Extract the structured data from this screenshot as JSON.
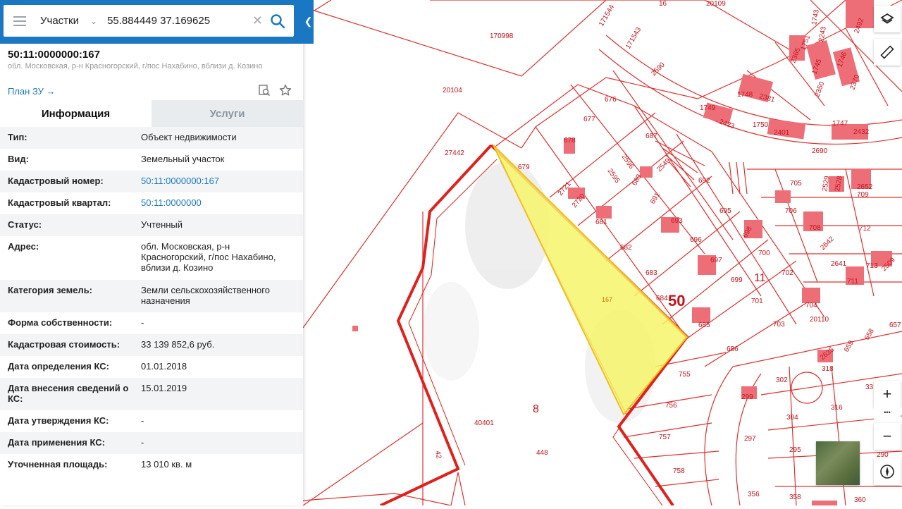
{
  "search": {
    "layer": "Участки",
    "query": "55.884449 37.169625"
  },
  "object": {
    "cadastral_number": "50:11:0000000:167",
    "address_short": "обл. Московская, р-н Красногорский, г/пос Нахабино, вблизи д. Козино",
    "plan_link": "План ЗУ"
  },
  "tabs": [
    {
      "label": "Информация",
      "active": true
    },
    {
      "label": "Услуги",
      "active": false
    }
  ],
  "info": [
    {
      "key": "Тип:",
      "value": "Объект недвижимости"
    },
    {
      "key": "Вид:",
      "value": "Земельный участок"
    },
    {
      "key": "Кадастровый номер:",
      "value": "50:11:0000000:167",
      "link": true
    },
    {
      "key": "Кадастровый квартал:",
      "value": "50:11:0000000",
      "link": true
    },
    {
      "key": "Статус:",
      "value": "Учтенный"
    },
    {
      "key": "Адрес:",
      "value": "обл. Московская, р-н Красногорский, г/пос Нахабино, вблизи д. Козино"
    },
    {
      "key": "Категория земель:",
      "value": "Земли сельскохозяйственного назначения"
    },
    {
      "key": "Форма собственности:",
      "value": "-"
    },
    {
      "key": "Кадастровая стоимость:",
      "value": "33 139 852,6 руб."
    },
    {
      "key": "Дата определения КС:",
      "value": "01.01.2018"
    },
    {
      "key": "Дата внесения сведений о КС:",
      "value": "15.01.2019"
    },
    {
      "key": "Дата утверждения КС:",
      "value": "-"
    },
    {
      "key": "Дата применения КС:",
      "value": "-"
    },
    {
      "key": "Уточненная площадь:",
      "value": "13 010 кв. м"
    }
  ],
  "map": {
    "highlight_color": "#f5f56a",
    "boundary_color": "#d0021b",
    "big_labels": [
      "8",
      "50",
      "11"
    ],
    "selected_label": "167",
    "labels": [
      "16",
      "20109",
      "170998",
      "171544",
      "171543",
      "2590",
      "20104",
      "27442",
      "676",
      "677",
      "678",
      "687",
      "679",
      "2596",
      "2595",
      "689",
      "2549",
      "692",
      "691",
      "2721",
      "2720",
      "681",
      "693",
      "695",
      "696",
      "698",
      "700",
      "682",
      "697",
      "683",
      "699",
      "702",
      "684",
      "701",
      "685",
      "703",
      "704",
      "20110",
      "686",
      "755",
      "302",
      "756",
      "299",
      "316",
      "304",
      "757",
      "297",
      "295",
      "758",
      "448",
      "40401",
      "42",
      "356",
      "358",
      "360",
      "290",
      "1748",
      "2381",
      "1749",
      "2423",
      "1750",
      "2401",
      "1747",
      "2432",
      "2690",
      "1743",
      "2243",
      "2365",
      "1751",
      "1745",
      "2350",
      "1746",
      "2370",
      "2492",
      "705",
      "2529",
      "2528",
      "709",
      "2652",
      "706",
      "708",
      "712",
      "2642",
      "2641",
      "713",
      "2509",
      "711",
      "657",
      "658",
      "659",
      "2635",
      "318",
      "33"
    ]
  },
  "controls": {
    "zoom_in": "+",
    "zoom_out": "−",
    "more": "•••"
  }
}
